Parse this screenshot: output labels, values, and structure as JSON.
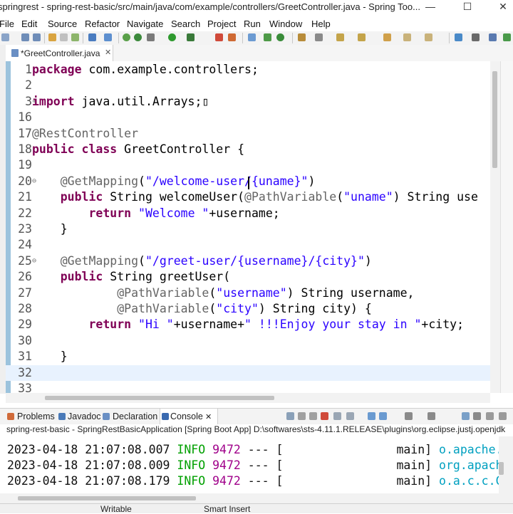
{
  "window": {
    "title": "springrest - spring-rest-basic/src/main/java/com/example/controllers/GreetController.java - Spring Too...",
    "minimize": "—",
    "maximize": "☐",
    "close": "✕"
  },
  "menu": [
    "File",
    "Edit",
    "Source",
    "Refactor",
    "Navigate",
    "Search",
    "Project",
    "Run",
    "Window",
    "Help"
  ],
  "editor_tab": {
    "label": "*GreetController.java",
    "close": "✕"
  },
  "code_lines": [
    {
      "n": "1",
      "fold": "",
      "html": "<span class=\"kw\">package</span> com.example.controllers;"
    },
    {
      "n": "2",
      "fold": "",
      "html": ""
    },
    {
      "n": "3",
      "fold": "+",
      "html": "<span class=\"kw\">import</span> java.util.Arrays;▯"
    },
    {
      "n": "16",
      "fold": "",
      "html": ""
    },
    {
      "n": "17",
      "fold": "",
      "html": "<span class=\"an\">@RestController</span>"
    },
    {
      "n": "18",
      "fold": "",
      "html": "<span class=\"kw\">public class</span> GreetController {"
    },
    {
      "n": "19",
      "fold": "",
      "html": ""
    },
    {
      "n": "20",
      "fold": "⊖",
      "html": "    <span class=\"an\">@GetMapping</span>(<span class=\"st\">\"/welcome-user/{uname}\"</span>)"
    },
    {
      "n": "21",
      "fold": "",
      "html": "    <span class=\"kw\">public</span> String welcomeUser(<span class=\"an\">@PathVariable</span>(<span class=\"st\">\"uname\"</span>) String use"
    },
    {
      "n": "22",
      "fold": "",
      "html": "        <span class=\"kw\">return</span> <span class=\"st\">\"Welcome \"</span>+username;"
    },
    {
      "n": "23",
      "fold": "",
      "html": "    }"
    },
    {
      "n": "24",
      "fold": "",
      "html": ""
    },
    {
      "n": "25",
      "fold": "⊖",
      "html": "    <span class=\"an\">@GetMapping</span>(<span class=\"st\">\"/greet-user/{username}/{city}\"</span>)"
    },
    {
      "n": "26",
      "fold": "",
      "html": "    <span class=\"kw\">public</span> String greetUser("
    },
    {
      "n": "27",
      "fold": "",
      "html": "            <span class=\"an\">@PathVariable</span>(<span class=\"st\">\"username\"</span>) String username,"
    },
    {
      "n": "28",
      "fold": "",
      "html": "            <span class=\"an\">@PathVariable</span>(<span class=\"st\">\"city\"</span>) String city) {"
    },
    {
      "n": "29",
      "fold": "",
      "html": "        <span class=\"kw\">return</span> <span class=\"st\">\"Hi \"</span>+username+<span class=\"st\">\" !!!Enjoy your stay in \"</span>+city;"
    },
    {
      "n": "30",
      "fold": "",
      "html": ""
    },
    {
      "n": "31",
      "fold": "",
      "html": "    }"
    },
    {
      "n": "32",
      "fold": "",
      "html": ""
    },
    {
      "n": "33",
      "fold": "",
      "html": ""
    }
  ],
  "current_line": "32",
  "panel_tabs": [
    "Problems",
    "Javadoc",
    "Declaration",
    "Console"
  ],
  "console_description": "spring-rest-basic - SpringRestBasicApplication [Spring Boot App] D:\\softwares\\sts-4.11.1.RELEASE\\plugins\\org.eclipse.justj.openjdk",
  "console_lines": [
    {
      "ts": "2023-04-18 21:07:08.007",
      "level": "INFO",
      "pid": "9472",
      "sep": "---",
      "bracket": "[",
      "thread": "main]",
      "logger": "o.apache.c"
    },
    {
      "ts": "2023-04-18 21:07:08.009",
      "level": "INFO",
      "pid": "9472",
      "sep": "---",
      "bracket": "[",
      "thread": "main]",
      "logger": "org.apache"
    },
    {
      "ts": "2023-04-18 21:07:08.179",
      "level": "INFO",
      "pid": "9472",
      "sep": "---",
      "bracket": "[",
      "thread": "main]",
      "logger": "o.a.c.c.C."
    }
  ],
  "status": {
    "writable": "Writable",
    "insert_mode": "Smart Insert"
  },
  "colors": {
    "keyword": "#7f0055",
    "string": "#2a00ff",
    "annotation": "#646464",
    "info": "#00a000",
    "current_line": "#e8f2fe"
  }
}
